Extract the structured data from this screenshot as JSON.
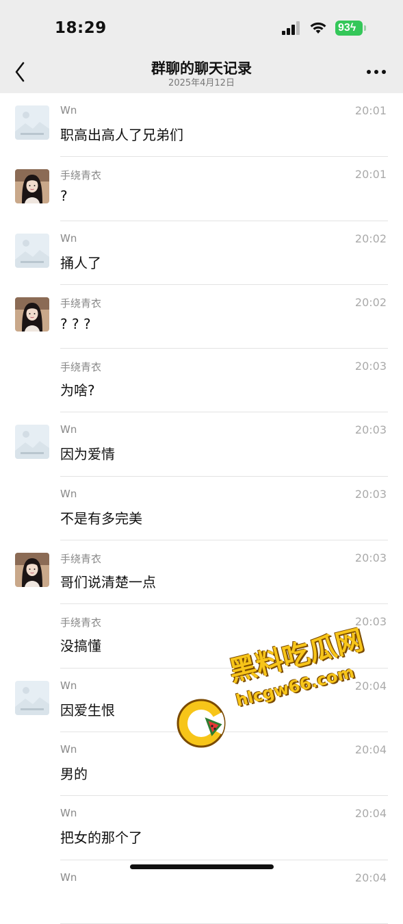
{
  "status_bar": {
    "time": "18:29",
    "battery": "93"
  },
  "nav": {
    "title": "群聊的聊天记录",
    "subtitle": "2025年4月12日"
  },
  "messages": [
    {
      "sender": "Wn",
      "time": "20:01",
      "text": "职高出高人了兄弟们",
      "avatar": "placeholder-image"
    },
    {
      "sender": "手绕青衣",
      "time": "20:01",
      "text": "?",
      "avatar": "girl-photo"
    },
    {
      "sender": "Wn",
      "time": "20:02",
      "text": "捅人了",
      "avatar": "placeholder-image"
    },
    {
      "sender": "手绕青衣",
      "time": "20:02",
      "text": "? ? ?",
      "avatar": "girl-photo"
    },
    {
      "sender": "手绕青衣",
      "time": "20:03",
      "text": "为啥?",
      "avatar": ""
    },
    {
      "sender": "Wn",
      "time": "20:03",
      "text": "因为爱情",
      "avatar": "placeholder-image"
    },
    {
      "sender": "Wn",
      "time": "20:03",
      "text": "不是有多完美",
      "avatar": ""
    },
    {
      "sender": "手绕青衣",
      "time": "20:03",
      "text": "哥们说清楚一点",
      "avatar": "girl-photo"
    },
    {
      "sender": "手绕青衣",
      "time": "20:03",
      "text": "没搞懂",
      "avatar": ""
    },
    {
      "sender": "Wn",
      "time": "20:04",
      "text": "因爱生恨",
      "avatar": "placeholder-image"
    },
    {
      "sender": "Wn",
      "time": "20:04",
      "text": "男的",
      "avatar": ""
    },
    {
      "sender": "Wn",
      "time": "20:04",
      "text": "把女的那个了",
      "avatar": ""
    },
    {
      "sender": "Wn",
      "time": "20:04",
      "text": "",
      "avatar": ""
    }
  ],
  "watermark": {
    "line1": "黑料吃瓜网",
    "line2": "hlcgw66.com"
  },
  "colors": {
    "header_bg": "#ededed",
    "battery": "#34c759",
    "watermark": "#f7c519"
  }
}
